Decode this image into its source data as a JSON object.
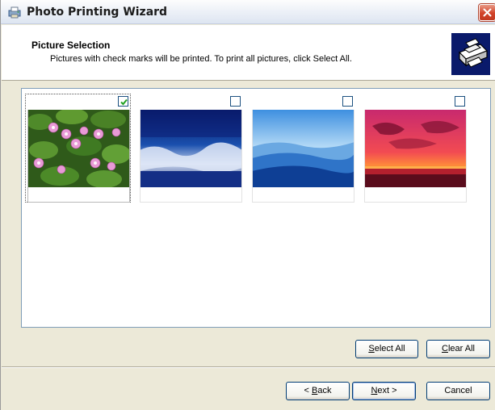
{
  "window": {
    "title": "Photo Printing Wizard",
    "app_icon": "printer-photo-icon"
  },
  "header": {
    "title": "Picture Selection",
    "subtitle": "Pictures with check marks will be printed.  To print all pictures, click Select All.",
    "icon": "printer-icon"
  },
  "thumbnails": [
    {
      "subject": "water lilies",
      "checked": true,
      "selected": true
    },
    {
      "subject": "winter frost",
      "checked": false,
      "selected": false
    },
    {
      "subject": "blue hills",
      "checked": false,
      "selected": false
    },
    {
      "subject": "sunset",
      "checked": false,
      "selected": false
    }
  ],
  "selection_buttons": {
    "select_all": {
      "accel": "S",
      "rest": "elect All"
    },
    "clear_all": {
      "accel": "C",
      "rest": "lear All"
    }
  },
  "nav": {
    "back": {
      "prefix": "< ",
      "accel": "B",
      "rest": "ack"
    },
    "next": {
      "accel": "N",
      "rest": "ext >"
    },
    "cancel": "Cancel"
  },
  "colors": {
    "accent": "#003c74",
    "checkmark": "#21a121",
    "header_icon_bg": "#0a1a6b",
    "close_red": "#d2432a"
  }
}
